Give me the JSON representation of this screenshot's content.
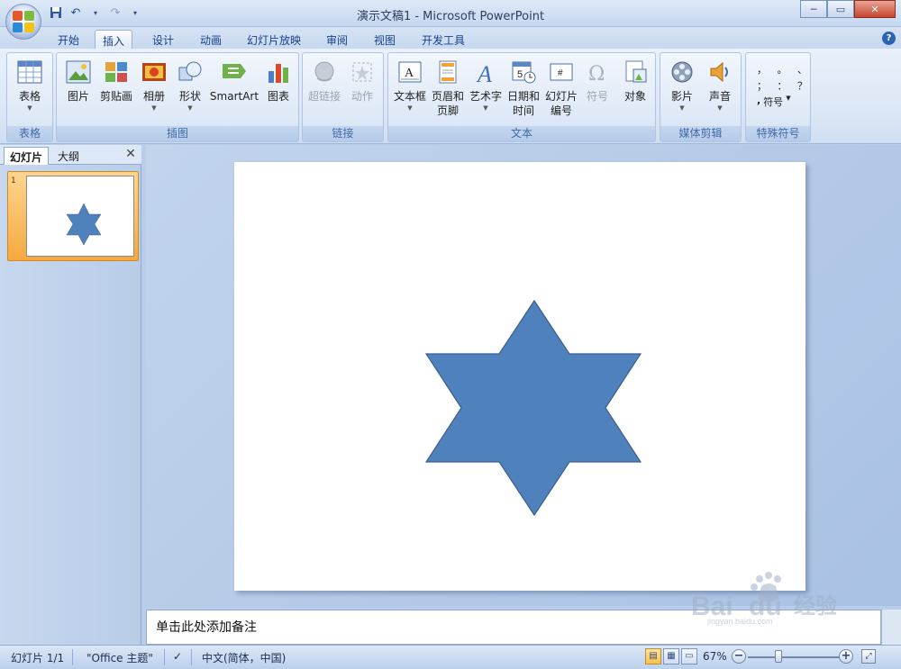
{
  "window": {
    "title": "演示文稿1 - Microsoft PowerPoint",
    "controls": [
      "minimize",
      "maximize",
      "close"
    ]
  },
  "tabs": [
    {
      "label": "开始",
      "active": false
    },
    {
      "label": "插入",
      "active": true
    },
    {
      "label": "设计",
      "active": false
    },
    {
      "label": "动画",
      "active": false
    },
    {
      "label": "幻灯片放映",
      "active": false
    },
    {
      "label": "审阅",
      "active": false
    },
    {
      "label": "视图",
      "active": false
    },
    {
      "label": "开发工具",
      "active": false
    }
  ],
  "ribbon": {
    "groups": {
      "table": {
        "label": "表格",
        "buttons": [
          {
            "label": "表格",
            "icon": "table-icon"
          }
        ]
      },
      "illustrations": {
        "label": "插图",
        "buttons": [
          {
            "label": "图片",
            "icon": "picture-icon"
          },
          {
            "label": "剪贴画",
            "icon": "clipart-icon"
          },
          {
            "label": "相册",
            "icon": "photo-album-icon"
          },
          {
            "label": "形状",
            "icon": "shapes-icon"
          },
          {
            "label": "SmartArt",
            "icon": "smartart-icon"
          },
          {
            "label": "图表",
            "icon": "chart-icon"
          }
        ]
      },
      "links": {
        "label": "链接",
        "buttons": [
          {
            "label": "超链接",
            "icon": "hyperlink-icon",
            "disabled": true
          },
          {
            "label": "动作",
            "icon": "action-icon",
            "disabled": true
          }
        ]
      },
      "text": {
        "label": "文本",
        "buttons": [
          {
            "label": "文本框",
            "icon": "textbox-icon"
          },
          {
            "label": "页眉和页脚",
            "icon": "header-footer-icon"
          },
          {
            "label": "艺术字",
            "icon": "wordart-icon"
          },
          {
            "label": "日期和时间",
            "icon": "date-time-icon"
          },
          {
            "label": "幻灯片编号",
            "icon": "slide-number-icon"
          },
          {
            "label": "符号",
            "icon": "omega-symbol-icon",
            "disabled": true
          },
          {
            "label": "对象",
            "icon": "object-icon"
          }
        ]
      },
      "media": {
        "label": "媒体剪辑",
        "buttons": [
          {
            "label": "影片",
            "icon": "movie-icon"
          },
          {
            "label": "声音",
            "icon": "sound-icon"
          }
        ]
      },
      "special_symbols": {
        "label": "特殊符号",
        "rows": [
          [
            "，",
            "。",
            "、"
          ],
          [
            "；",
            "：",
            "？"
          ]
        ],
        "button": "符号"
      }
    }
  },
  "left_pane": {
    "tabs": [
      "幻灯片",
      "大纲"
    ],
    "active_tab": "幻灯片",
    "slides": [
      {
        "number": "1"
      }
    ]
  },
  "slide": {
    "shape": "six-point-star",
    "fill": "#4f81bd",
    "stroke": "#3a5f8f"
  },
  "notes": {
    "placeholder": "单击此处添加备注"
  },
  "status_bar": {
    "slide_info": "幻灯片 1/1",
    "theme": "\"Office 主题\"",
    "language": "中文(简体，中国)",
    "zoom": "67%"
  },
  "colors": {
    "accent": "#4f81bd",
    "ribbon_bg": "#dbe6f5",
    "selected_thumb": "#f4a93f"
  }
}
